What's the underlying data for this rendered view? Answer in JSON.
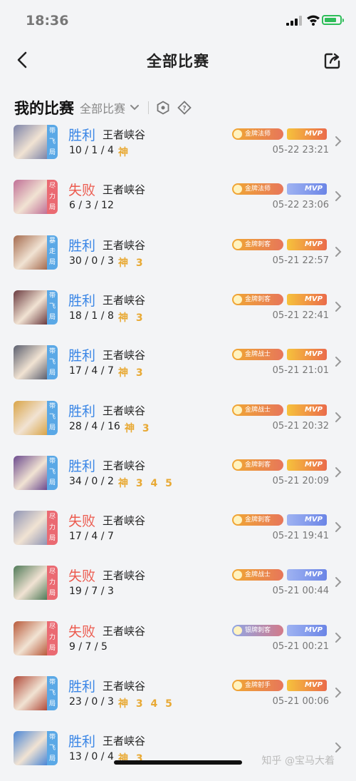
{
  "status_bar": {
    "time": "18:36"
  },
  "nav": {
    "title": "全部比赛"
  },
  "filter": {
    "mine": "我的比赛",
    "all": "全部比赛"
  },
  "matches": [
    {
      "result": "胜利",
      "win": true,
      "mode": "王者峡谷",
      "kda": "10 / 1 / 4",
      "shen": "神",
      "tag": [
        "带",
        "飞",
        "局"
      ],
      "tag_color": "blue",
      "badge": "金牌法师",
      "badge_tier": "gold",
      "mvp": "MVP",
      "mvp_color": "gold",
      "time": "05-22 23:21",
      "avatar_color": "#7c83a8"
    },
    {
      "result": "失败",
      "win": false,
      "mode": "王者峡谷",
      "kda": "6 / 3 / 12",
      "shen": "",
      "tag": [
        "尽",
        "力",
        "局"
      ],
      "tag_color": "red",
      "badge": "金牌法师",
      "badge_tier": "gold",
      "mvp": "MVP",
      "mvp_color": "blue",
      "time": "05-22 23:06",
      "avatar_color": "#c06f96"
    },
    {
      "result": "胜利",
      "win": true,
      "mode": "王者峡谷",
      "kda": "30 / 0 / 3",
      "shen": "神 3",
      "tag": [
        "暴",
        "走",
        "局"
      ],
      "tag_color": "blue",
      "badge": "金牌刺客",
      "badge_tier": "gold",
      "mvp": "MVP",
      "mvp_color": "gold",
      "time": "05-21 22:57",
      "avatar_color": "#a46a4e"
    },
    {
      "result": "胜利",
      "win": true,
      "mode": "王者峡谷",
      "kda": "18 / 1 / 8",
      "shen": "神 3",
      "tag": [
        "带",
        "飞",
        "局"
      ],
      "tag_color": "blue",
      "badge": "金牌刺客",
      "badge_tier": "gold",
      "mvp": "MVP",
      "mvp_color": "gold",
      "time": "05-21 22:41",
      "avatar_color": "#6a3a3f"
    },
    {
      "result": "胜利",
      "win": true,
      "mode": "王者峡谷",
      "kda": "17 / 4 / 7",
      "shen": "神 3",
      "tag": [
        "带",
        "飞",
        "局"
      ],
      "tag_color": "blue",
      "badge": "金牌战士",
      "badge_tier": "gold",
      "mvp": "MVP",
      "mvp_color": "gold",
      "time": "05-21 21:01",
      "avatar_color": "#5a5e6e"
    },
    {
      "result": "胜利",
      "win": true,
      "mode": "王者峡谷",
      "kda": "28 / 4 / 16",
      "shen": "神 3",
      "tag": [
        "带",
        "飞",
        "局"
      ],
      "tag_color": "blue",
      "badge": "金牌战士",
      "badge_tier": "gold",
      "mvp": "MVP",
      "mvp_color": "gold",
      "time": "05-21 20:32",
      "avatar_color": "#d9a447"
    },
    {
      "result": "胜利",
      "win": true,
      "mode": "王者峡谷",
      "kda": "34 / 0 / 2",
      "shen": "神 3 4 5",
      "tag": [
        "带",
        "飞",
        "局"
      ],
      "tag_color": "blue",
      "badge": "金牌刺客",
      "badge_tier": "gold",
      "mvp": "MVP",
      "mvp_color": "gold",
      "time": "05-21 20:09",
      "avatar_color": "#6b4a8e"
    },
    {
      "result": "失败",
      "win": false,
      "mode": "王者峡谷",
      "kda": "17 / 4 / 7",
      "shen": "",
      "tag": [
        "尽",
        "力",
        "局"
      ],
      "tag_color": "red",
      "badge": "金牌刺客",
      "badge_tier": "gold",
      "mvp": "MVP",
      "mvp_color": "blue",
      "time": "05-21 19:41",
      "avatar_color": "#8f95b5"
    },
    {
      "result": "失败",
      "win": false,
      "mode": "王者峡谷",
      "kda": "19 / 7 / 3",
      "shen": "",
      "tag": [
        "尽",
        "力",
        "局"
      ],
      "tag_color": "red",
      "badge": "金牌战士",
      "badge_tier": "gold",
      "mvp": "MVP",
      "mvp_color": "blue",
      "time": "05-21 00:44",
      "avatar_color": "#4f7a58"
    },
    {
      "result": "失败",
      "win": false,
      "mode": "王者峡谷",
      "kda": "9 / 7 / 5",
      "shen": "",
      "tag": [
        "尽",
        "力",
        "局"
      ],
      "tag_color": "red",
      "badge": "银牌刺客",
      "badge_tier": "silver",
      "mvp": "MVP",
      "mvp_color": "blue",
      "time": "05-21 00:21",
      "avatar_color": "#b8593a"
    },
    {
      "result": "胜利",
      "win": true,
      "mode": "王者峡谷",
      "kda": "23 / 0 / 3",
      "shen": "神 3 4 5",
      "tag": [
        "带",
        "飞",
        "局"
      ],
      "tag_color": "blue",
      "badge": "金牌射手",
      "badge_tier": "gold",
      "mvp": "MVP",
      "mvp_color": "gold",
      "time": "05-21 00:06",
      "avatar_color": "#b04a3a"
    },
    {
      "result": "胜利",
      "win": true,
      "mode": "王者峡谷",
      "kda": "13 / 0 / 4",
      "shen": "神 3",
      "tag": [
        "带",
        "飞",
        "局"
      ],
      "tag_color": "blue",
      "badge": "",
      "badge_tier": "gold",
      "mvp": "",
      "mvp_color": "gold",
      "time": "",
      "avatar_color": "#4a86d6"
    }
  ],
  "watermark": "知乎 @宝马大着"
}
